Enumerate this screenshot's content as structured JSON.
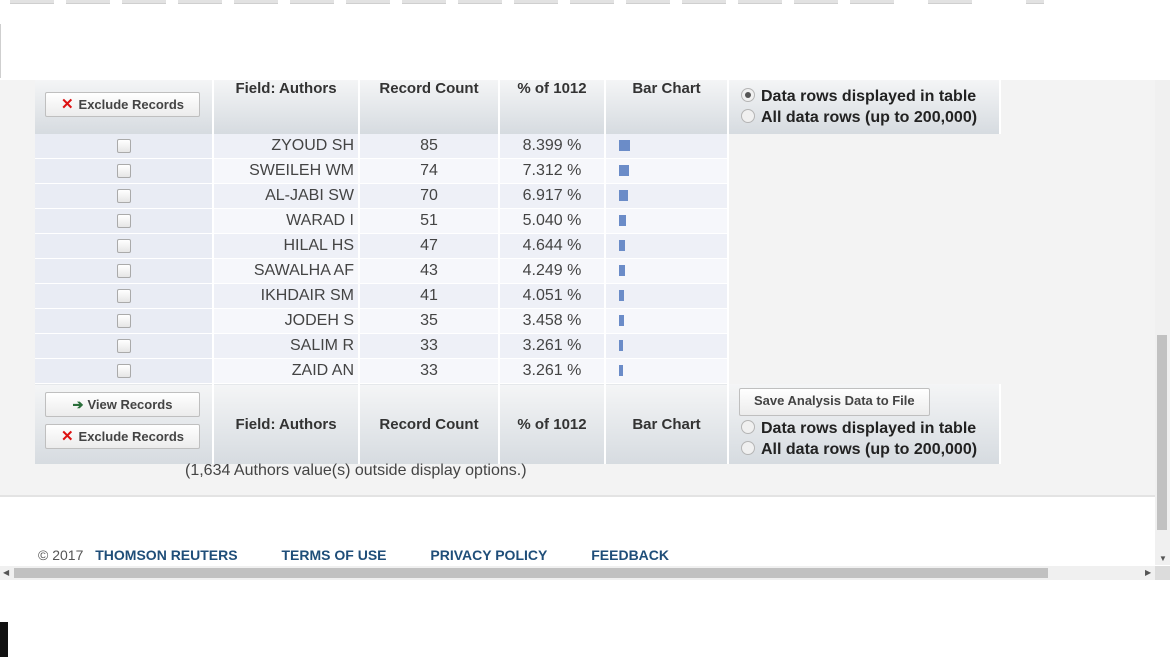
{
  "buttons": {
    "exclude_records": "Exclude Records",
    "view_records": "View Records",
    "save_analysis": "Save Analysis Data to File"
  },
  "headers": {
    "field": "Field: Authors",
    "count": "Record Count",
    "pct": "% of 1012",
    "bar": "Bar Chart"
  },
  "options": {
    "displayed": "Data rows displayed in table",
    "all": "All data rows (up to 200,000)"
  },
  "rows": [
    {
      "name": "ZYOUD SH",
      "count": "85",
      "pct": "8.399 %",
      "value": 8.399
    },
    {
      "name": "SWEILEH WM",
      "count": "74",
      "pct": "7.312 %",
      "value": 7.312
    },
    {
      "name": "AL-JABI SW",
      "count": "70",
      "pct": "6.917 %",
      "value": 6.917
    },
    {
      "name": "WARAD I",
      "count": "51",
      "pct": "5.040 %",
      "value": 5.04
    },
    {
      "name": "HILAL HS",
      "count": "47",
      "pct": "4.644 %",
      "value": 4.644
    },
    {
      "name": "SAWALHA AF",
      "count": "43",
      "pct": "4.249 %",
      "value": 4.249
    },
    {
      "name": "IKHDAIR SM",
      "count": "41",
      "pct": "4.051 %",
      "value": 4.051
    },
    {
      "name": "JODEH S",
      "count": "35",
      "pct": "3.458 %",
      "value": 3.458
    },
    {
      "name": "SALIM R",
      "count": "33",
      "pct": "3.261 %",
      "value": 3.261
    },
    {
      "name": "ZAID AN",
      "count": "33",
      "pct": "3.261 %",
      "value": 3.261
    }
  ],
  "outside_note": "(1,634 Authors value(s) outside display options.)",
  "footer": {
    "copyright": "© 2017",
    "links": [
      "THOMSON REUTERS",
      "TERMS OF USE",
      "PRIVACY POLICY",
      "FEEDBACK"
    ]
  },
  "colors": {
    "bar": "#6b8cc8",
    "link": "#1f4e79",
    "exclude_icon": "#dd1111"
  }
}
